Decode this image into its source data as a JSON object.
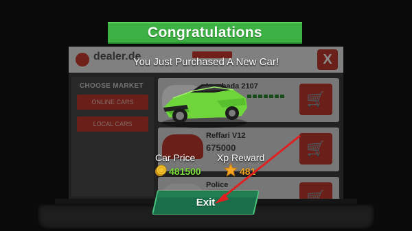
{
  "popup": {
    "title": "Congratulations",
    "message": "You Just Purchased A New Car!",
    "car_price_label": "Car Price",
    "car_price_value": "481500",
    "xp_label": "Xp Reward",
    "xp_value": "481",
    "exit_label": "Exit"
  },
  "dealer": {
    "name": "dealer.de",
    "close_label": "X",
    "market_title": "CHOOSE MARKET",
    "markets": [
      "ONLINE CARS",
      "LOCAL CARS"
    ],
    "listings": [
      {
        "name": "Lambada 2107",
        "price": ""
      },
      {
        "name": "Reffari V12",
        "price": "675000"
      },
      {
        "name": "Police",
        "price": ""
      }
    ]
  },
  "colors": {
    "banner_green": "#3cb043",
    "price_green": "#7ee03a",
    "xp_orange": "#f5a623",
    "exit_teal": "#1b6e4a",
    "car_green": "#6ed63a",
    "arrow_red": "#e02020"
  }
}
